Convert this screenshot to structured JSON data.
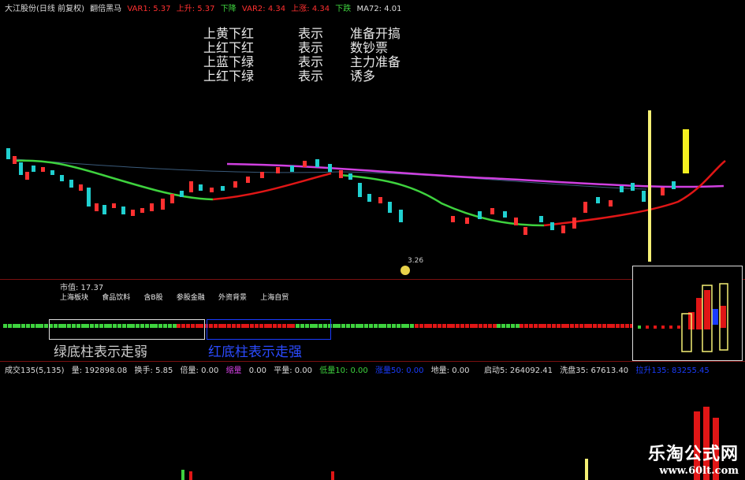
{
  "header": {
    "stock": "大江股份(日线 前复权)",
    "indicator": "翻倍黑马",
    "var1": "VAR1: 5.37",
    "shang_sheng": "上升: 5.37",
    "xia_jiang": "下降",
    "var2": "VAR2: 4.34",
    "shang_zhang": "上涨: 4.34",
    "xia_die": "下跌",
    "ma72": "MA72: 4.01"
  },
  "legend": [
    {
      "c1": "上黄下红",
      "c2": "表示",
      "c3": "准备开搞"
    },
    {
      "c1": "上红下红",
      "c2": "表示",
      "c3": "数钞票"
    },
    {
      "c1": "上蓝下绿",
      "c2": "表示",
      "c3": "主力准备"
    },
    {
      "c1": "上红下绿",
      "c2": "表示",
      "c3": "诱多"
    }
  ],
  "annotations": {
    "price_low": "3.26"
  },
  "info": {
    "market_value": "市值: 17.37",
    "tags": [
      "上海板块",
      "食品饮料",
      "含B股",
      "参股金融",
      "外资背景",
      "上海自贸"
    ]
  },
  "captions": {
    "green": "绿底柱表示走弱",
    "red": "红底柱表示走强"
  },
  "volume_header": {
    "chengjiao": "成交135(5,135)",
    "liang": "量: 192898.08",
    "huanshou": "换手: 5.85",
    "beiliang": "倍量: 0.00",
    "xiaoliang_label": "缩量",
    "xiaoliang": "0.00",
    "pingliang": "平量: 0.00",
    "diliang": "低量10: 0.00",
    "zhangliang": "涨量50: 0.00",
    "diliang2": "地量: 0.00",
    "qidong": "启动5: 264092.41",
    "xipan": "洗盘35: 67613.40",
    "lapan": "拉升135: 83255.45"
  },
  "watermark": {
    "title": "乐淘公式网",
    "url": "www.60lt.com"
  },
  "colors": {
    "background": "#000000",
    "candle_up": "#ff3030",
    "candle_down": "#20d0d0",
    "line_green": "#3ed23e",
    "line_red": "#e01616",
    "line_magenta": "#d040e0",
    "line_yellow": "#f5f075",
    "separator": "#7a1010"
  },
  "strength_dots": {
    "pattern": "G=green,R=red",
    "sequence": "GGGGGGGGGGGGGGGGGGGGGGGGGGGGGGGGGGGGGGRRRRRRRRRRRRRRRRRRRRRRRRRRGGGGGGGGGGGGGGGGGGGGGGGGGGRRRRRRRRRRRRRRRRRRGGGGGRRRRRRRRRRRRRRRRRRRRRRRRRRRRRRRR"
  }
}
